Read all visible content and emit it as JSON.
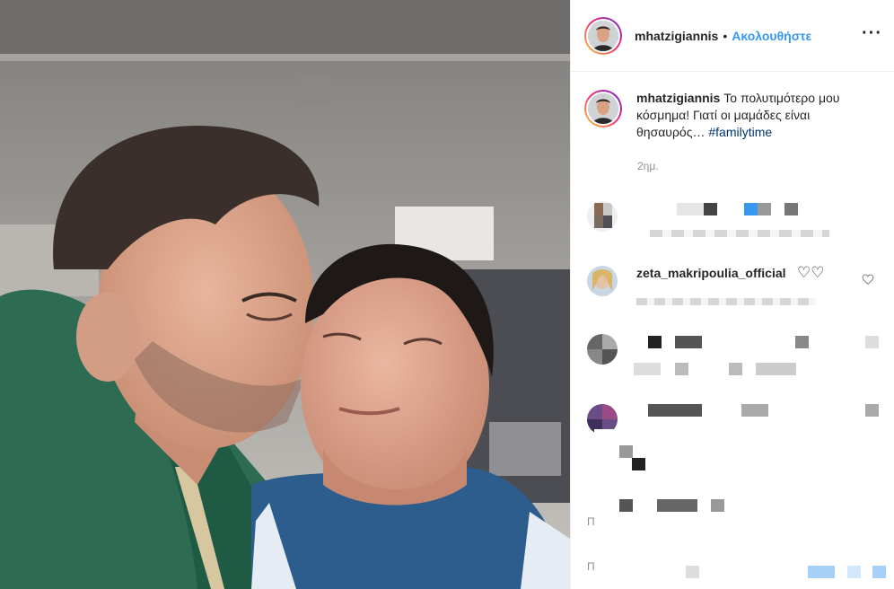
{
  "post": {
    "username": "mhatzigiannis",
    "follow_label": "Ακολουθήστε",
    "separator": "•",
    "more_label": "···"
  },
  "caption": {
    "username": "mhatzigiannis",
    "text": "Το πολυτιμότερο μου κόσμημα! Γιατί οι μαμάδες είναι θησαυρός…",
    "hashtag": "#familytime",
    "time": "2ημ."
  },
  "comments": [
    {
      "username": "zeta_makripoulia_official",
      "text": "♡♡"
    }
  ],
  "colors": {
    "link": "#3897f0",
    "hashtag": "#003569",
    "muted": "#8e8e8e",
    "text": "#262626"
  },
  "icons": [
    "more-options-icon",
    "heart-icon"
  ]
}
